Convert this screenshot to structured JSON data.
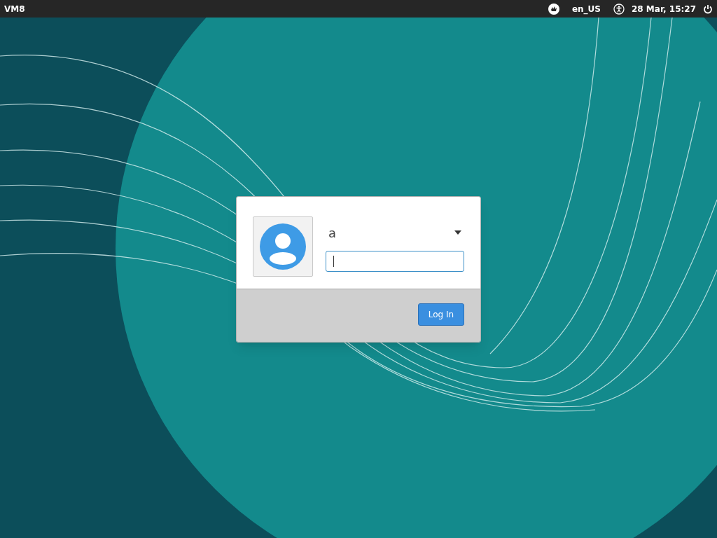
{
  "top_bar": {
    "host": "VM8",
    "keyboard_layout": "en_US",
    "datetime": "28 Mar, 15:27"
  },
  "login": {
    "username": "a",
    "button": "Log In"
  }
}
